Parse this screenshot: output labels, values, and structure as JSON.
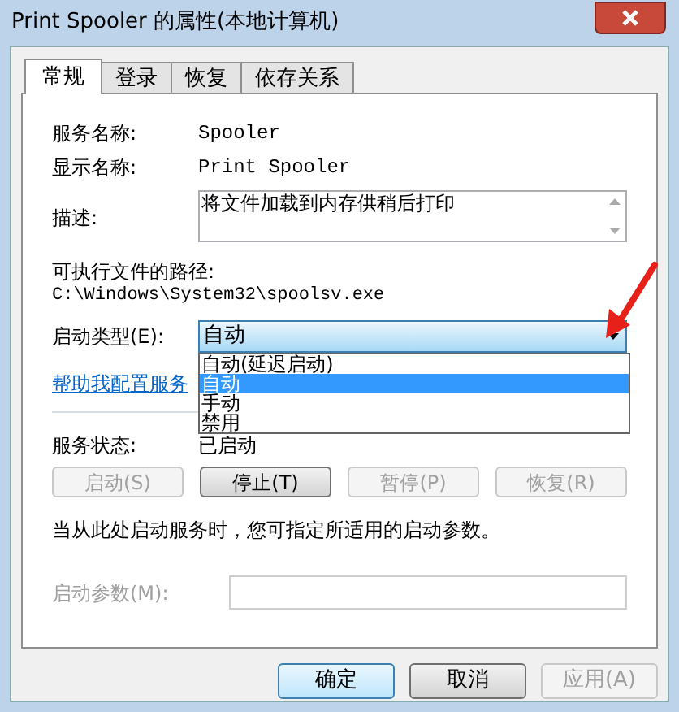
{
  "window": {
    "title": "Print Spooler 的属性(本地计算机)"
  },
  "tabs": [
    {
      "label": "常规",
      "selected": true
    },
    {
      "label": "登录",
      "selected": false
    },
    {
      "label": "恢复",
      "selected": false
    },
    {
      "label": "依存关系",
      "selected": false
    }
  ],
  "service_name": {
    "label": "服务名称:",
    "value": "Spooler"
  },
  "display_name": {
    "label": "显示名称:",
    "value": "Print Spooler"
  },
  "description": {
    "label": "描述:",
    "value": "将文件加载到内存供稍后打印"
  },
  "path": {
    "label": "可执行文件的路径:",
    "value": "C:\\Windows\\System32\\spoolsv.exe"
  },
  "startup_type": {
    "label": "启动类型(E):",
    "value": "自动",
    "expanded": true,
    "options": [
      {
        "label": "自动(延迟启动)",
        "selected": false
      },
      {
        "label": "自动",
        "selected": true
      },
      {
        "label": "手动",
        "selected": false
      },
      {
        "label": "禁用",
        "selected": false
      }
    ]
  },
  "help_link": "帮助我配置服务",
  "service_status": {
    "label": "服务状态:",
    "value": "已启动"
  },
  "service_buttons": [
    {
      "label": "启动(S)",
      "disabled": true
    },
    {
      "label": "停止(T)",
      "disabled": false
    },
    {
      "label": "暂停(P)",
      "disabled": true
    },
    {
      "label": "恢复(R)",
      "disabled": true
    }
  ],
  "note": "当从此处启动服务时，您可指定所适用的启动参数。",
  "start_params": {
    "label": "启动参数(M):",
    "disabled": true
  },
  "dialog_buttons": [
    {
      "label": "确定",
      "default": true,
      "disabled": false
    },
    {
      "label": "取消",
      "default": false,
      "disabled": false
    },
    {
      "label": "应用(A)",
      "default": false,
      "disabled": true
    }
  ]
}
